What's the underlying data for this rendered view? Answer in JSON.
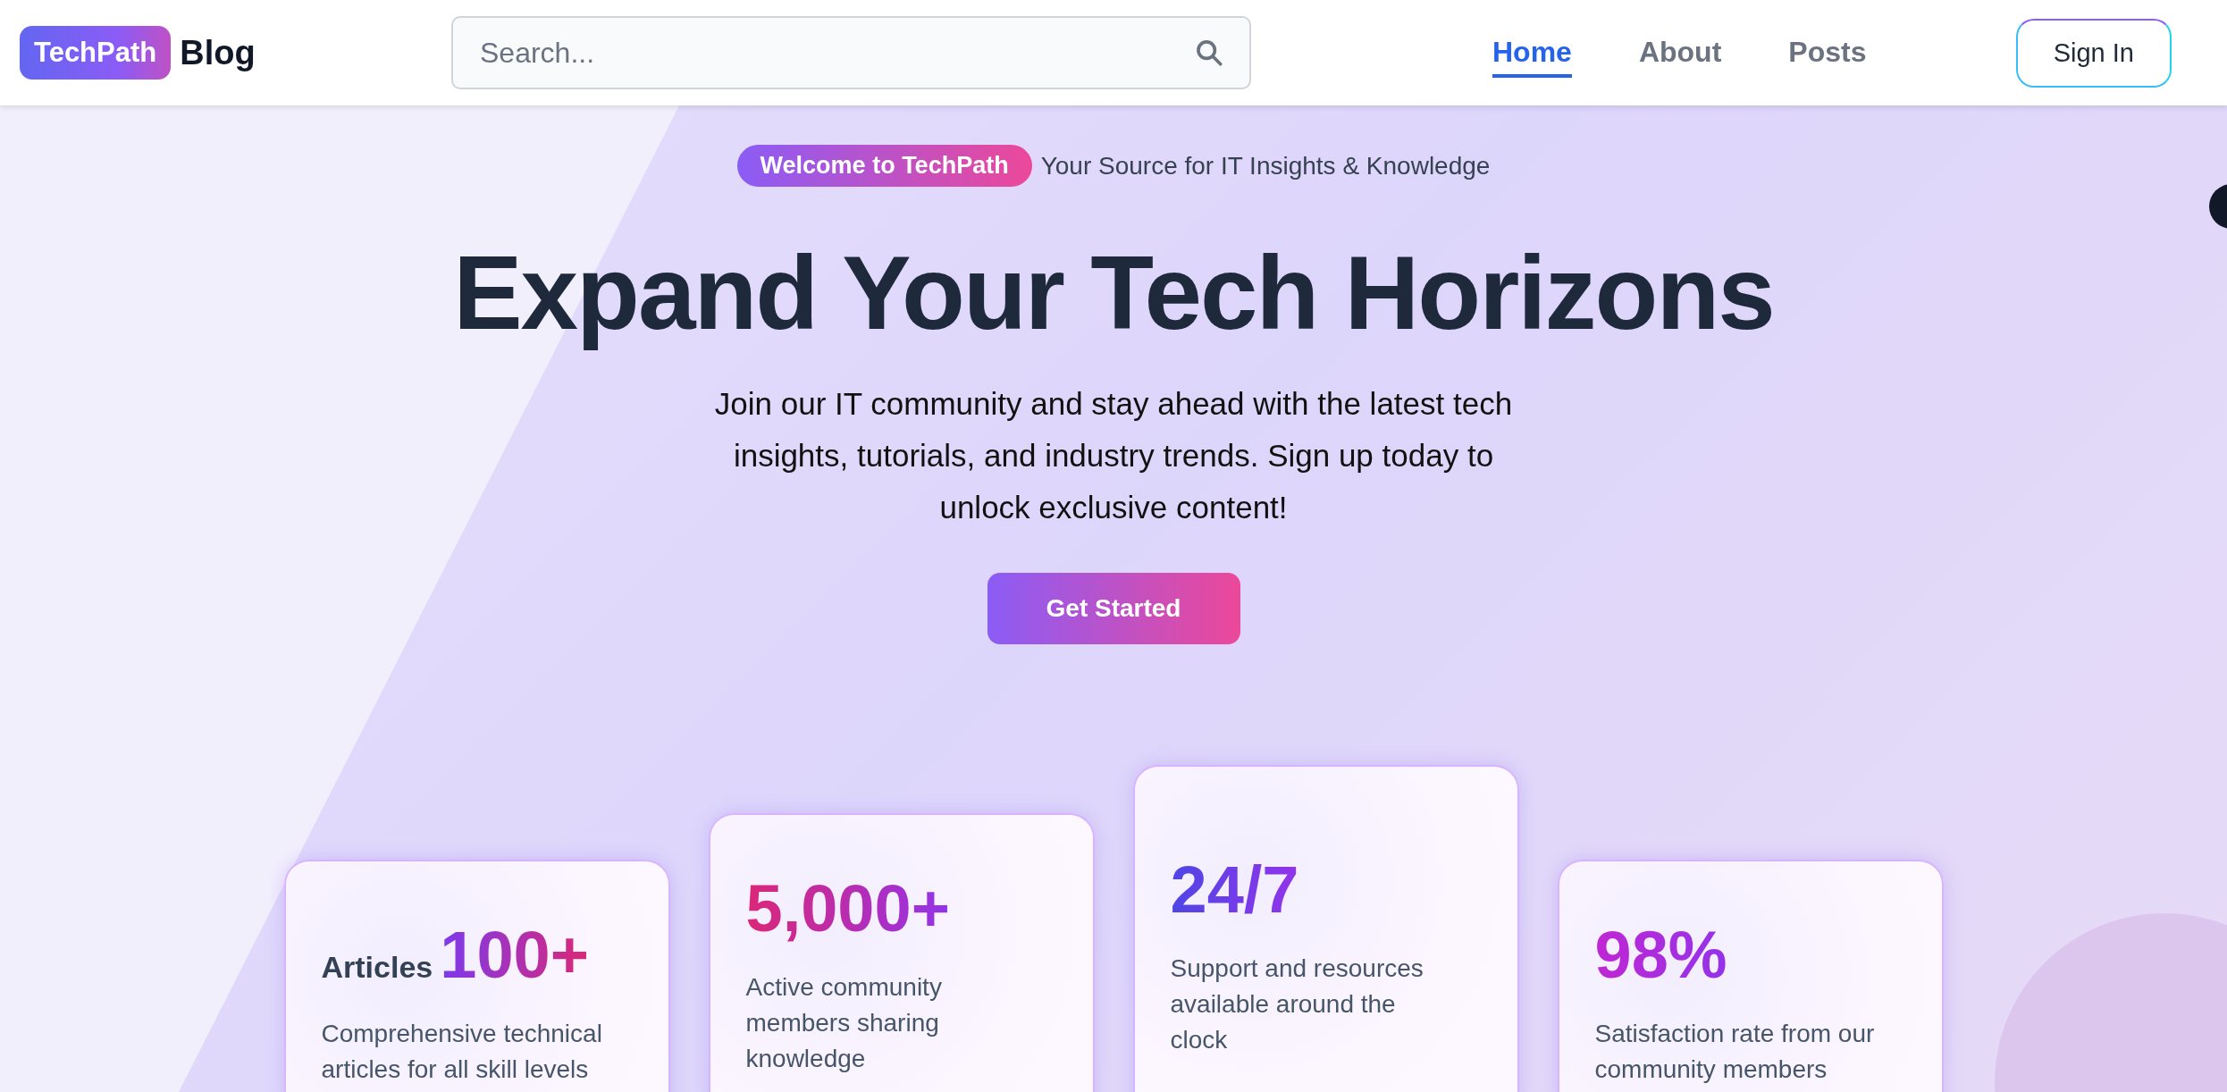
{
  "header": {
    "logo": {
      "badge": "TechPath",
      "text": "Blog"
    },
    "search": {
      "placeholder": "Search..."
    },
    "nav": [
      {
        "label": "Home",
        "selected": true
      },
      {
        "label": "About",
        "selected": false
      },
      {
        "label": "Posts",
        "selected": false
      }
    ],
    "sign_in": "Sign In"
  },
  "hero": {
    "badge": "Welcome to TechPath",
    "tagline": "Your Source for IT Insights & Knowledge",
    "title": "Expand Your Tech Horizons",
    "description": "Join our IT community and stay ahead with the latest tech insights, tutorials, and industry trends. Sign up today to unlock exclusive content!",
    "button": "Get Started"
  },
  "stats": [
    {
      "label": "Articles",
      "value": "100+",
      "description": "Comprehensive technical articles for all skill levels"
    },
    {
      "value": "5,000+",
      "description": "Active community members sharing knowledge"
    },
    {
      "value": "24/7",
      "description": "Support and resources available around the clock"
    },
    {
      "value": "98%",
      "description": "Satisfaction rate from our community members"
    }
  ]
}
